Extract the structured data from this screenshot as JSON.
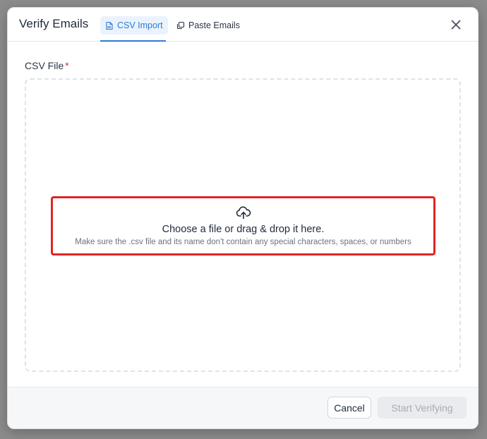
{
  "dialog": {
    "title": "Verify Emails",
    "tabs": [
      {
        "label": "CSV Import",
        "icon": "file-csv-icon",
        "active": true
      },
      {
        "label": "Paste Emails",
        "icon": "copy-icon",
        "active": false
      }
    ],
    "close_icon": "close-icon"
  },
  "form": {
    "field_label": "CSV File",
    "required_marker": "*",
    "dropzone": {
      "icon": "cloud-upload-icon",
      "title": "Choose a file or drag & drop it here.",
      "hint": "Make sure the .csv file and its name don't contain any special characters, spaces, or numbers"
    }
  },
  "footer": {
    "cancel_label": "Cancel",
    "start_label": "Start Verifying",
    "start_disabled": true
  },
  "colors": {
    "accent": "#2d7ad6",
    "required": "#e03131",
    "highlight_border": "#e02424"
  }
}
